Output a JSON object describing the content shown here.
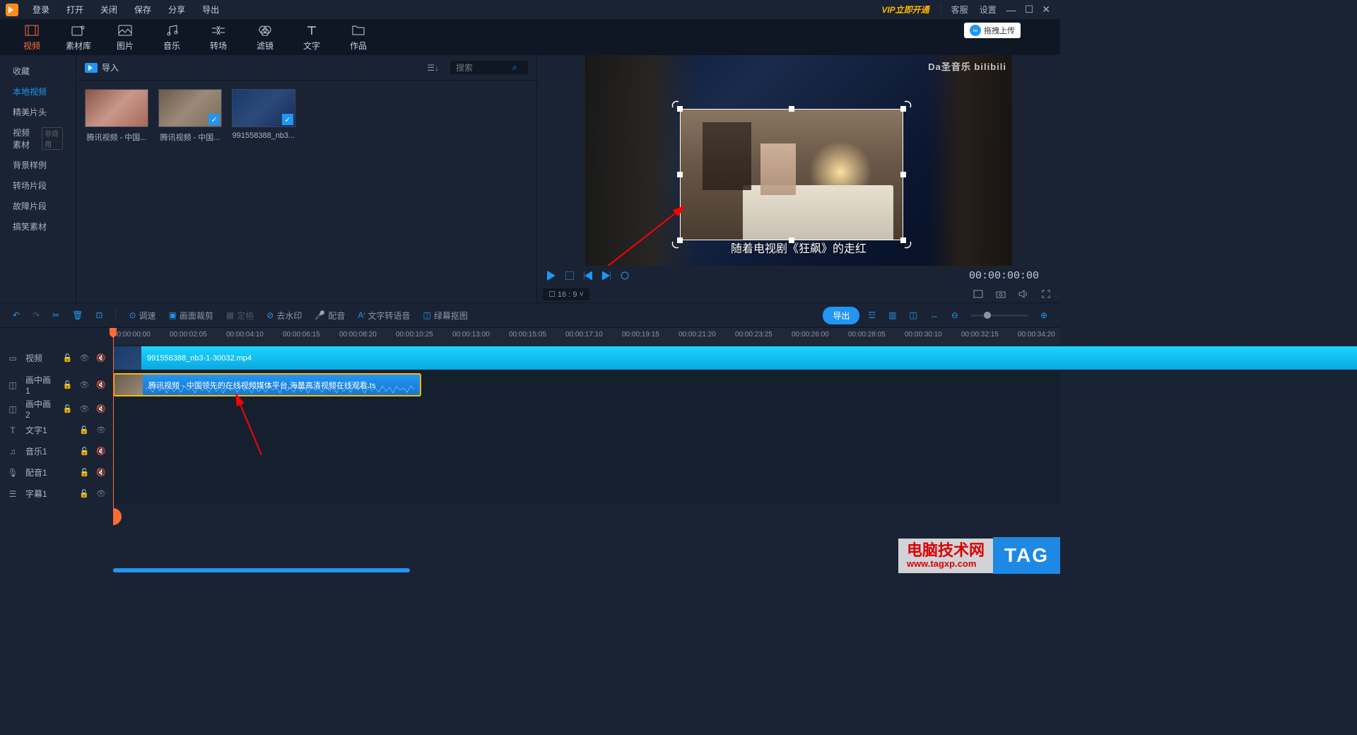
{
  "menubar": {
    "login": "登录",
    "items": [
      "打开",
      "关闭",
      "保存",
      "分享",
      "导出"
    ],
    "vip": "VIP立即开通",
    "right": [
      "客服",
      "设置"
    ]
  },
  "main_tabs": [
    {
      "label": "视频",
      "active": true
    },
    {
      "label": "素材库"
    },
    {
      "label": "图片"
    },
    {
      "label": "音乐"
    },
    {
      "label": "转场"
    },
    {
      "label": "滤镜"
    },
    {
      "label": "文字"
    },
    {
      "label": "作品"
    }
  ],
  "left_nav": [
    {
      "label": "收藏"
    },
    {
      "label": "本地视频",
      "active": true
    },
    {
      "label": "精美片头"
    },
    {
      "label": "视频素材",
      "tag": "非商用"
    },
    {
      "label": "背景样例"
    },
    {
      "label": "转场片段"
    },
    {
      "label": "故障片段"
    },
    {
      "label": "搞笑素材"
    }
  ],
  "bin": {
    "import": "导入",
    "search_ph": "搜索",
    "items": [
      {
        "label": "腾讯视频 - 中国...",
        "checked": false
      },
      {
        "label": "腾讯视频 - 中国...",
        "checked": true
      },
      {
        "label": "991558388_nb3...",
        "checked": true
      }
    ]
  },
  "preview": {
    "upload": "拖拽上传",
    "watermark": "Da圣音乐 bilibili",
    "subtitle": "随着电视剧《狂飙》的走红",
    "timecode": "00:00:00:00",
    "aspect": "16 : 9"
  },
  "tl_tools": {
    "speed": "调速",
    "crop": "画面裁剪",
    "freeze": "定格",
    "dewm": "去水印",
    "dub": "配音",
    "tts": "文字转语音",
    "greensc": "绿幕抠图",
    "export": "导出"
  },
  "ruler": [
    "00:00:00:00",
    "00:00:02:05",
    "00:00:04:10",
    "00:00:06:15",
    "00:00:08:20",
    "00:00:10:25",
    "00:00:13:00",
    "00:00:15:05",
    "00:00:17:10",
    "00:00:19:15",
    "00:00:21:20",
    "00:00:23:25",
    "00:00:26:00",
    "00:00:28:05",
    "00:00:30:10",
    "00:00:32:15",
    "00:00:34:20"
  ],
  "tracks": [
    {
      "icon": "film",
      "label": "视频",
      "lock": true,
      "eye": true,
      "mute": true,
      "tall": true,
      "id": "video"
    },
    {
      "icon": "pip",
      "label": "画中画1",
      "lock": true,
      "eye": true,
      "mute": true,
      "tall": true,
      "id": "pip1"
    },
    {
      "icon": "pip",
      "label": "画中画2",
      "lock": true,
      "eye": true,
      "mute": true,
      "id": "pip2"
    },
    {
      "icon": "text",
      "label": "文字1",
      "lock": true,
      "eye": true,
      "id": "text1"
    },
    {
      "icon": "music",
      "label": "音乐1",
      "lock": true,
      "mute": true,
      "id": "music1"
    },
    {
      "icon": "mic",
      "label": "配音1",
      "lock": true,
      "mute": true,
      "id": "dub1"
    },
    {
      "icon": "sub",
      "label": "字幕1",
      "lock": true,
      "eye": true,
      "id": "sub1"
    }
  ],
  "clips": {
    "video": "991558388_nb3-1-30032.mp4",
    "pip": "腾讯视频 - 中国领先的在线视频媒体平台,海量高清视频在线观看.ts"
  },
  "watermark": {
    "l1": "电脑技术网",
    "l2": "www.tagxp.com",
    "tag": "TAG"
  }
}
